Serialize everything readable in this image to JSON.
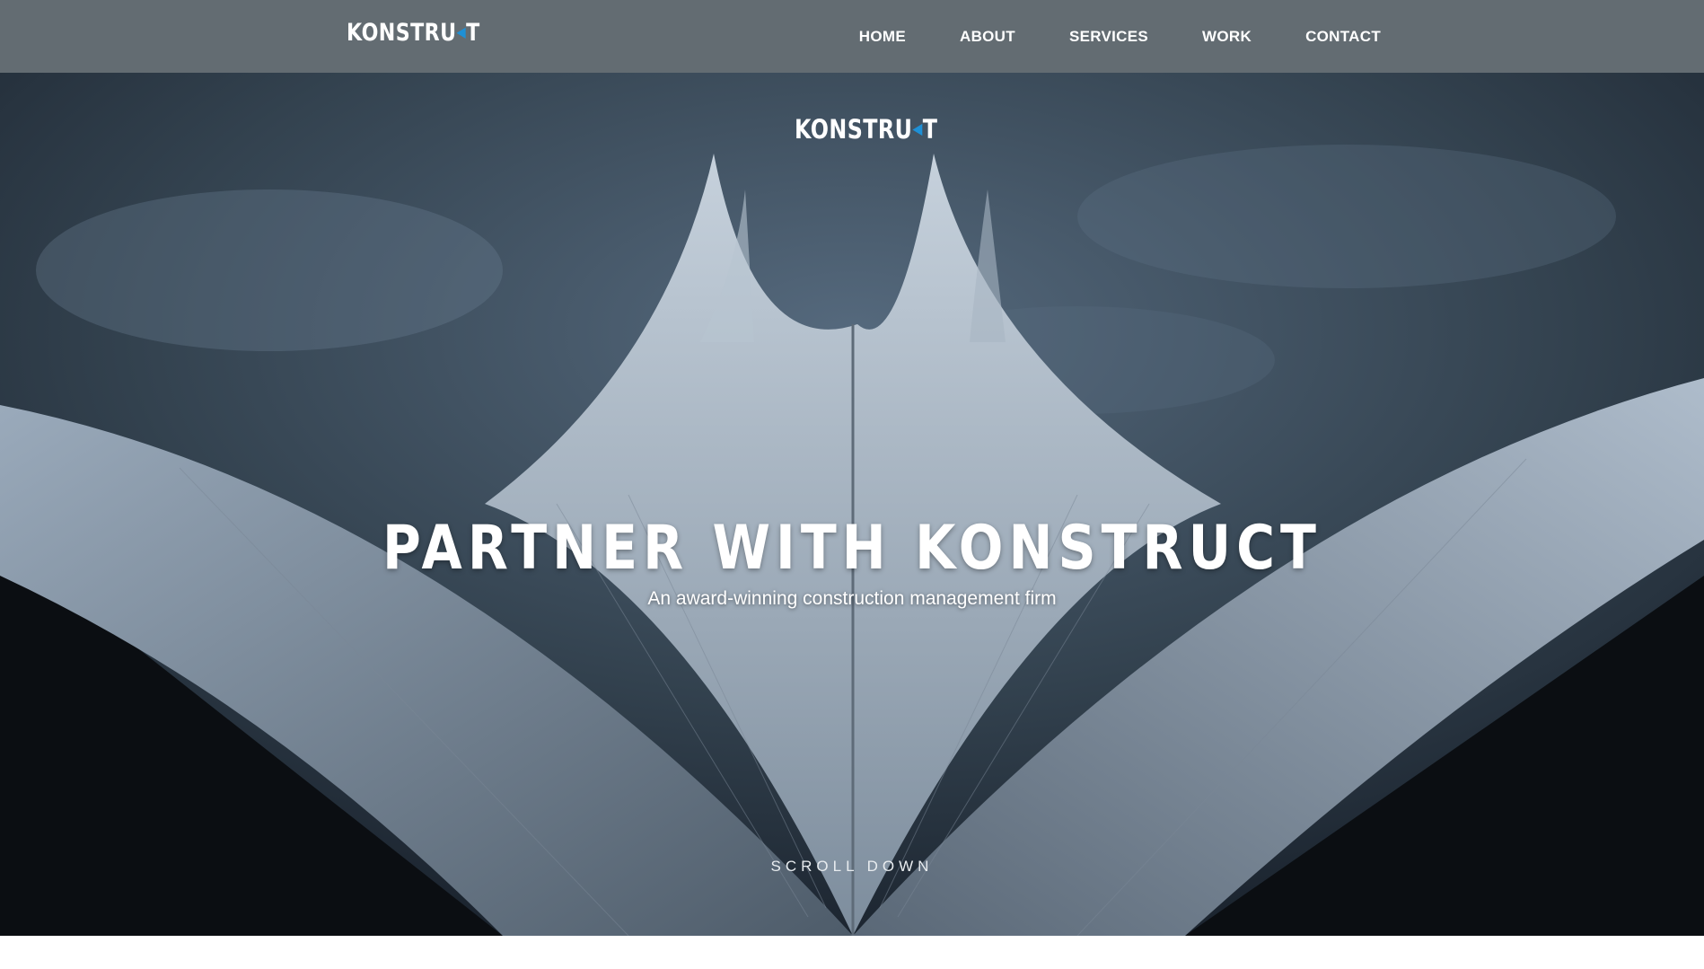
{
  "navbar": {
    "logo": {
      "text_before": "KONSTRU",
      "accent_glyph": "◀",
      "text_after": "T"
    },
    "links": [
      "HOME",
      "ABOUT",
      "SERVICES",
      "WORK",
      "CONTACT"
    ]
  },
  "hero": {
    "logo": {
      "text_before": "KONSTRU",
      "accent_glyph": "◀",
      "text_after": "T"
    },
    "title": "PARTNER WITH KONSTRUCT",
    "subtitle": "An award-winning construction management firm",
    "scroll_label": "SCROLL DOWN",
    "background_image": "tent-roof-peaks-under-stormy-sky"
  },
  "colors": {
    "navbar_bg": "#636c72",
    "logo_accent": "#1e90d6",
    "text": "#ffffff"
  }
}
